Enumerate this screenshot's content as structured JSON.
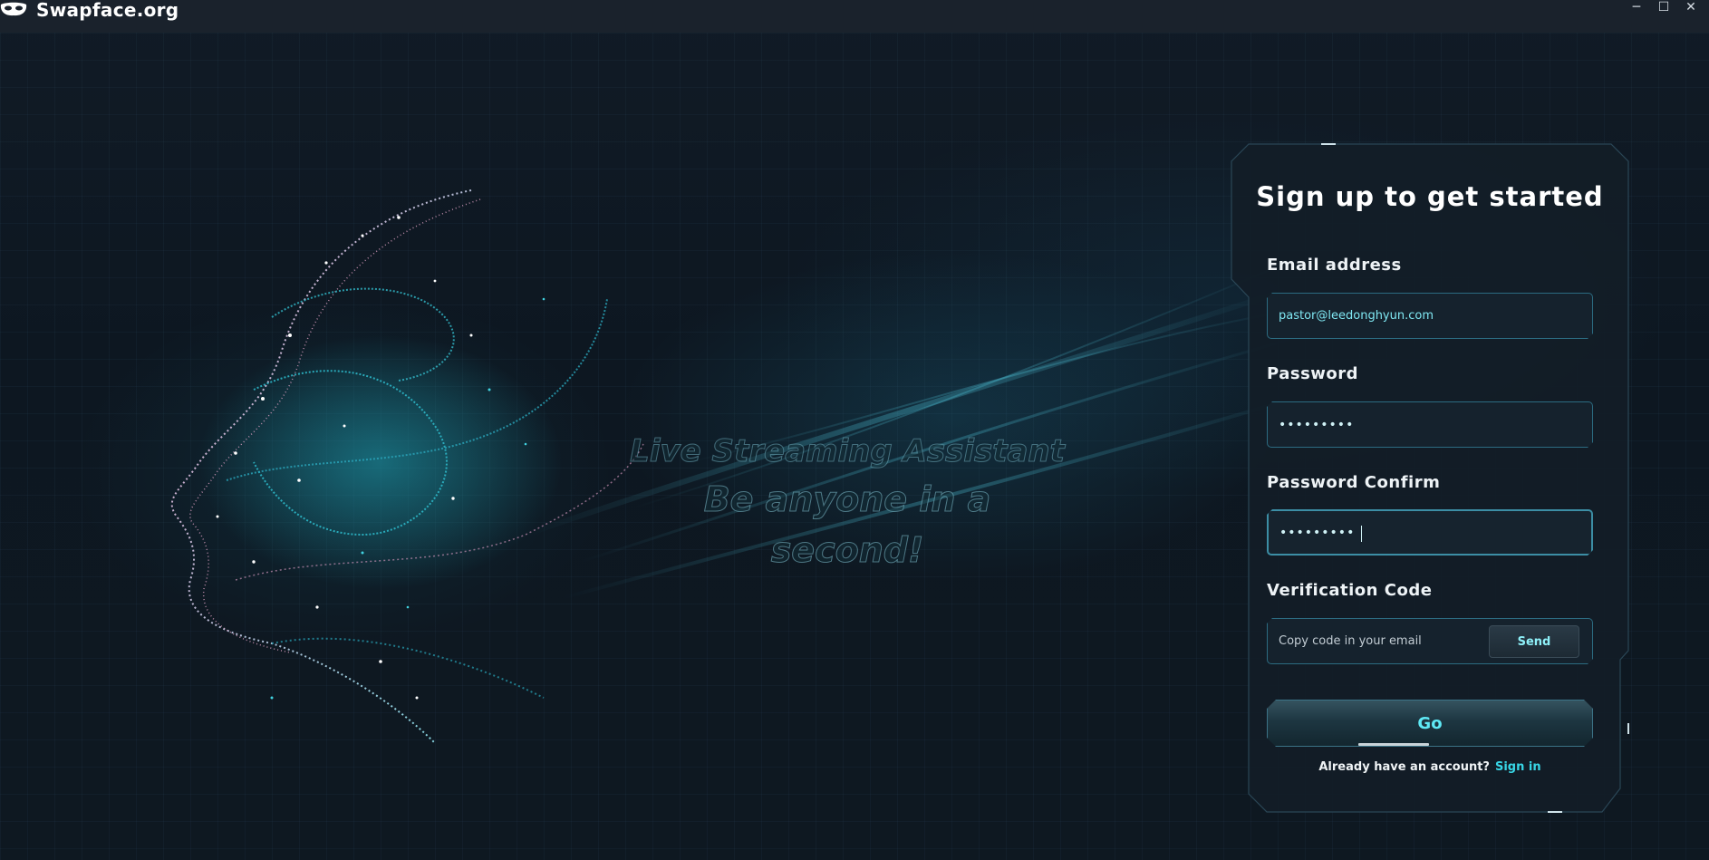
{
  "app": {
    "title": "Swapface.org"
  },
  "window_controls": {
    "minimize": "─",
    "maximize": "☐",
    "close": "✕"
  },
  "hero": {
    "line1": "Live Streaming Assistant",
    "line2": "Be anyone in a second!"
  },
  "signup": {
    "title": "Sign up to get started",
    "email_label": "Email address",
    "email_value": "pastor@leedonghyun.com",
    "password_label": "Password",
    "password_value": "•••••••••",
    "password_confirm_label": "Password Confirm",
    "password_confirm_value": "•••••••••",
    "verification_label": "Verification Code",
    "verification_placeholder": "Copy code in your email",
    "send_label": "Send",
    "go_label": "Go",
    "already_text": "Already have an account?",
    "signin_label": "Sign in"
  },
  "colors": {
    "accent": "#38d6e6",
    "field_border": "#2c6c82",
    "background": "#0d1620"
  },
  "icons": {
    "logo": "mask-icon",
    "minimize": "minimize-icon",
    "maximize": "maximize-icon",
    "close": "close-icon"
  }
}
